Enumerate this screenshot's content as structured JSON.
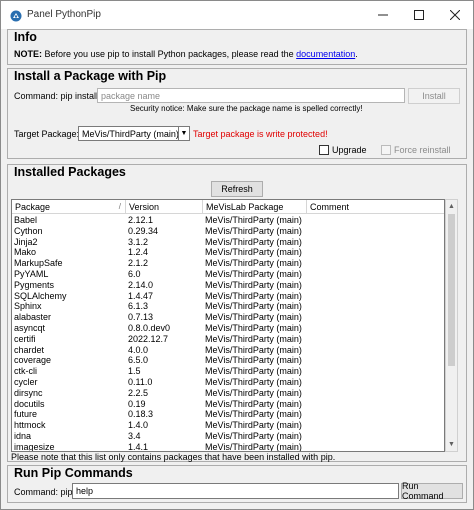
{
  "window": {
    "title": "Panel PythonPip"
  },
  "info": {
    "title": "Info",
    "note_label": "NOTE:",
    "note_text": " Before you use pip to install Python packages, please read the ",
    "doc_link": "documentation",
    "note_end": "."
  },
  "install": {
    "title": "Install a Package with Pip",
    "command_label": "Command: pip install",
    "package_placeholder": "package name",
    "install_button": "Install",
    "security_notice": "Security notice: Make sure the package name is spelled correctly!",
    "target_label": "Target Package:",
    "target_value": "MeVis/ThirdParty (main)",
    "protected_warning": "Target package is write protected!",
    "upgrade_label": "Upgrade",
    "force_reinstall_label": "Force reinstall",
    "warning_color": "#e00000"
  },
  "installed": {
    "title": "Installed Packages",
    "refresh_button": "Refresh",
    "columns": [
      "Package",
      "Version",
      "MeVisLab Package",
      "Comment"
    ],
    "rows": [
      [
        "Babel",
        "2.12.1",
        "MeVis/ThirdParty (main)",
        ""
      ],
      [
        "Cython",
        "0.29.34",
        "MeVis/ThirdParty (main)",
        ""
      ],
      [
        "Jinja2",
        "3.1.2",
        "MeVis/ThirdParty (main)",
        ""
      ],
      [
        "Mako",
        "1.2.4",
        "MeVis/ThirdParty (main)",
        ""
      ],
      [
        "MarkupSafe",
        "2.1.2",
        "MeVis/ThirdParty (main)",
        ""
      ],
      [
        "PyYAML",
        "6.0",
        "MeVis/ThirdParty (main)",
        ""
      ],
      [
        "Pygments",
        "2.14.0",
        "MeVis/ThirdParty (main)",
        ""
      ],
      [
        "SQLAlchemy",
        "1.4.47",
        "MeVis/ThirdParty (main)",
        ""
      ],
      [
        "Sphinx",
        "6.1.3",
        "MeVis/ThirdParty (main)",
        ""
      ],
      [
        "alabaster",
        "0.7.13",
        "MeVis/ThirdParty (main)",
        ""
      ],
      [
        "asyncqt",
        "0.8.0.dev0",
        "MeVis/ThirdParty (main)",
        ""
      ],
      [
        "certifi",
        "2022.12.7",
        "MeVis/ThirdParty (main)",
        ""
      ],
      [
        "chardet",
        "4.0.0",
        "MeVis/ThirdParty (main)",
        ""
      ],
      [
        "coverage",
        "6.5.0",
        "MeVis/ThirdParty (main)",
        ""
      ],
      [
        "ctk-cli",
        "1.5",
        "MeVis/ThirdParty (main)",
        ""
      ],
      [
        "cycler",
        "0.11.0",
        "MeVis/ThirdParty (main)",
        ""
      ],
      [
        "dirsync",
        "2.2.5",
        "MeVis/ThirdParty (main)",
        ""
      ],
      [
        "docutils",
        "0.19",
        "MeVis/ThirdParty (main)",
        ""
      ],
      [
        "future",
        "0.18.3",
        "MeVis/ThirdParty (main)",
        ""
      ],
      [
        "httmock",
        "1.4.0",
        "MeVis/ThirdParty (main)",
        ""
      ],
      [
        "idna",
        "3.4",
        "MeVis/ThirdParty (main)",
        ""
      ],
      [
        "imagesize",
        "1.4.1",
        "MeVis/ThirdParty (main)",
        ""
      ]
    ],
    "footnote": "Please note that this list only contains packages that have been installed with pip."
  },
  "run": {
    "title": "Run Pip Commands",
    "command_label": "Command: pip",
    "command_value": "help",
    "run_button": "Run Command"
  }
}
